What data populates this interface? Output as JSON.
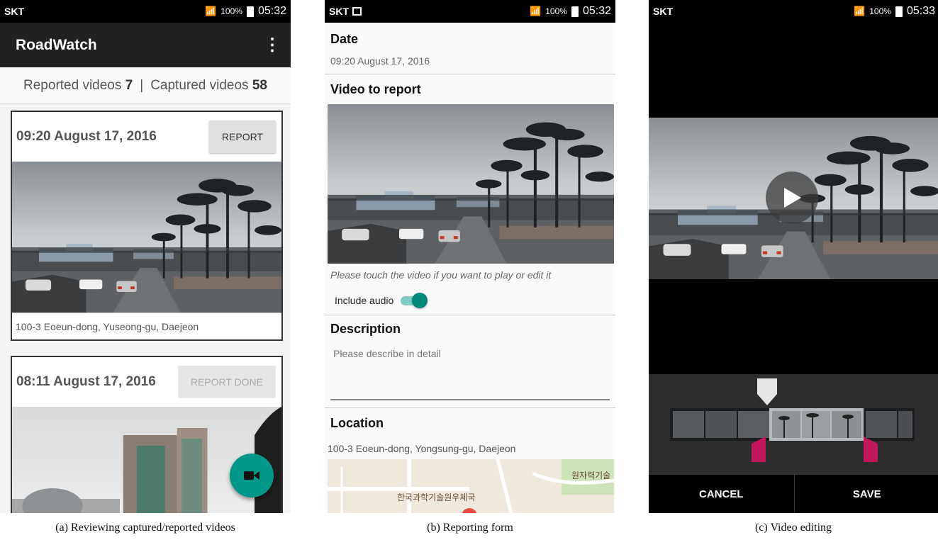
{
  "status_bars": [
    {
      "carrier": "SKT",
      "battery": "100%",
      "time": "05:32"
    },
    {
      "carrier": "SKT",
      "battery": "100%",
      "time": "05:32"
    },
    {
      "carrier": "SKT",
      "battery": "100%",
      "time": "05:33"
    }
  ],
  "screen1": {
    "app_title": "RoadWatch",
    "counts": {
      "reported_label": "Reported videos",
      "reported_value": "7",
      "separator": "|",
      "captured_label": "Captured videos",
      "captured_value": "58"
    },
    "cards": [
      {
        "date": "09:20 August 17, 2016",
        "button": "REPORT",
        "address": "100-3 Eoeun-dong, Yuseong-gu, Daejeon"
      },
      {
        "date": "08:11 August 17, 2016",
        "button": "REPORT DONE"
      }
    ]
  },
  "screen2": {
    "date_title": "Date",
    "date_value": "09:20 August 17, 2016",
    "video_title": "Video to report",
    "video_hint": "Please touch the video if you want to play or edit it",
    "audio_label": "Include audio",
    "audio_enabled": true,
    "description_title": "Description",
    "description_placeholder": "Please describe in detail",
    "location_title": "Location",
    "location_value": "100-3 Eoeun-dong, Yongsung-gu, Daejeon",
    "map_labels": [
      "원자력기술",
      "한국과학기술원우체국"
    ]
  },
  "screen3": {
    "cancel_label": "CANCEL",
    "save_label": "SAVE"
  },
  "captions": [
    "(a) Reviewing captured/reported videos",
    "(b) Reporting form",
    "(c) Video editing"
  ],
  "colors": {
    "accent": "#009688",
    "toggle_track": "#80cbc4",
    "trim_handle": "#c2185b",
    "appbar": "#212121"
  },
  "icons": [
    "signal-icon",
    "battery-icon",
    "overflow-menu-icon",
    "videocam-icon",
    "play-icon",
    "screenshot-icon"
  ]
}
